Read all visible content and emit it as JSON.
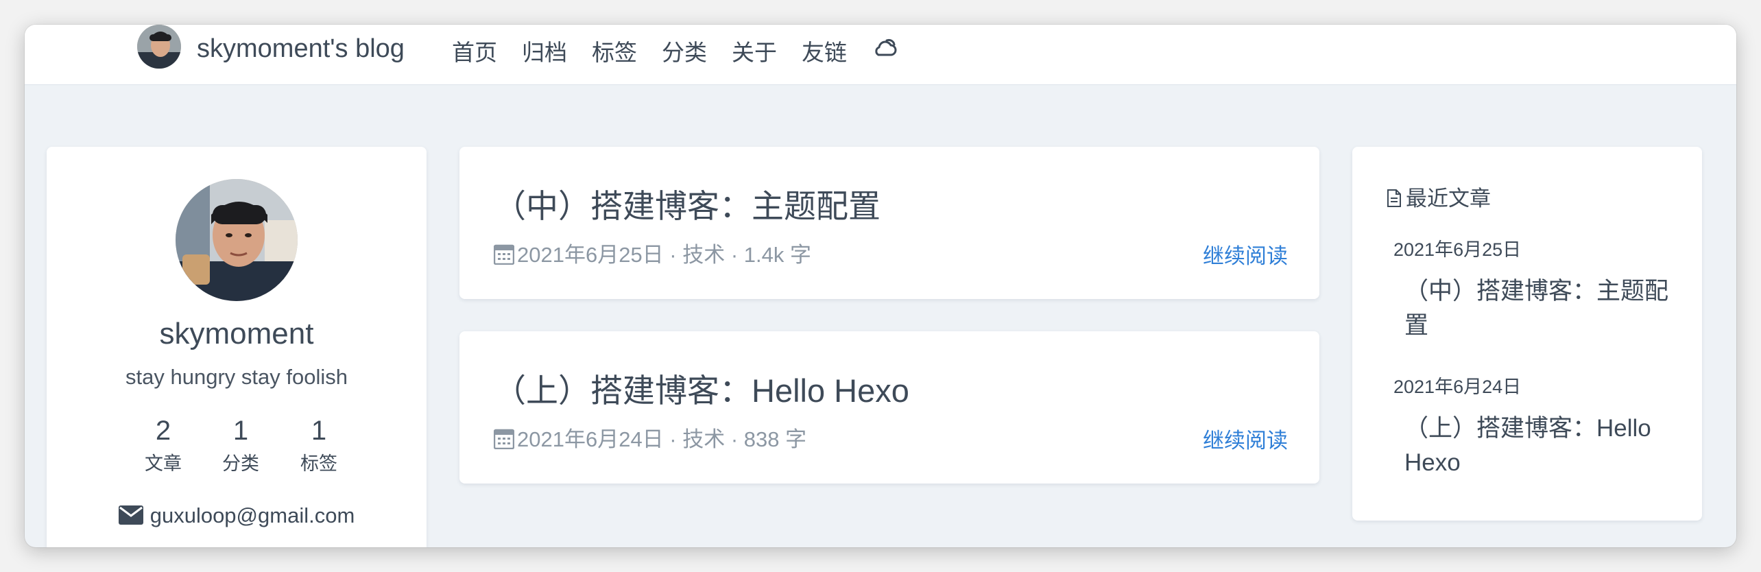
{
  "header": {
    "brand_title": "skymoment's blog",
    "nav": [
      "首页",
      "归档",
      "标签",
      "分类",
      "关于",
      "友链"
    ],
    "theme_icon": "cloud-moon-icon"
  },
  "profile": {
    "name": "skymoment",
    "motto": "stay hungry stay foolish",
    "stats": [
      {
        "value": "2",
        "label": "文章"
      },
      {
        "value": "1",
        "label": "分类"
      },
      {
        "value": "1",
        "label": "标签"
      }
    ],
    "email": "guxuloop@gmail.com"
  },
  "posts": [
    {
      "title": "（中）搭建博客：主题配置",
      "meta": "2021年6月25日 · 技术 · 1.4k 字",
      "read_more": "继续阅读"
    },
    {
      "title": "（上）搭建博客：Hello Hexo",
      "meta": "2021年6月24日 · 技术 · 838 字",
      "read_more": "继续阅读"
    }
  ],
  "recent": {
    "heading": "最近文章",
    "items": [
      {
        "date": "2021年6月25日",
        "title": "（中）搭建博客：主题配置"
      },
      {
        "date": "2021年6月24日",
        "title": "（上）搭建博客：Hello Hexo"
      }
    ]
  },
  "colors": {
    "accent": "#2f7fd7",
    "text": "#3e4a58",
    "muted": "#8c97a3",
    "background": "#eef2f6"
  }
}
